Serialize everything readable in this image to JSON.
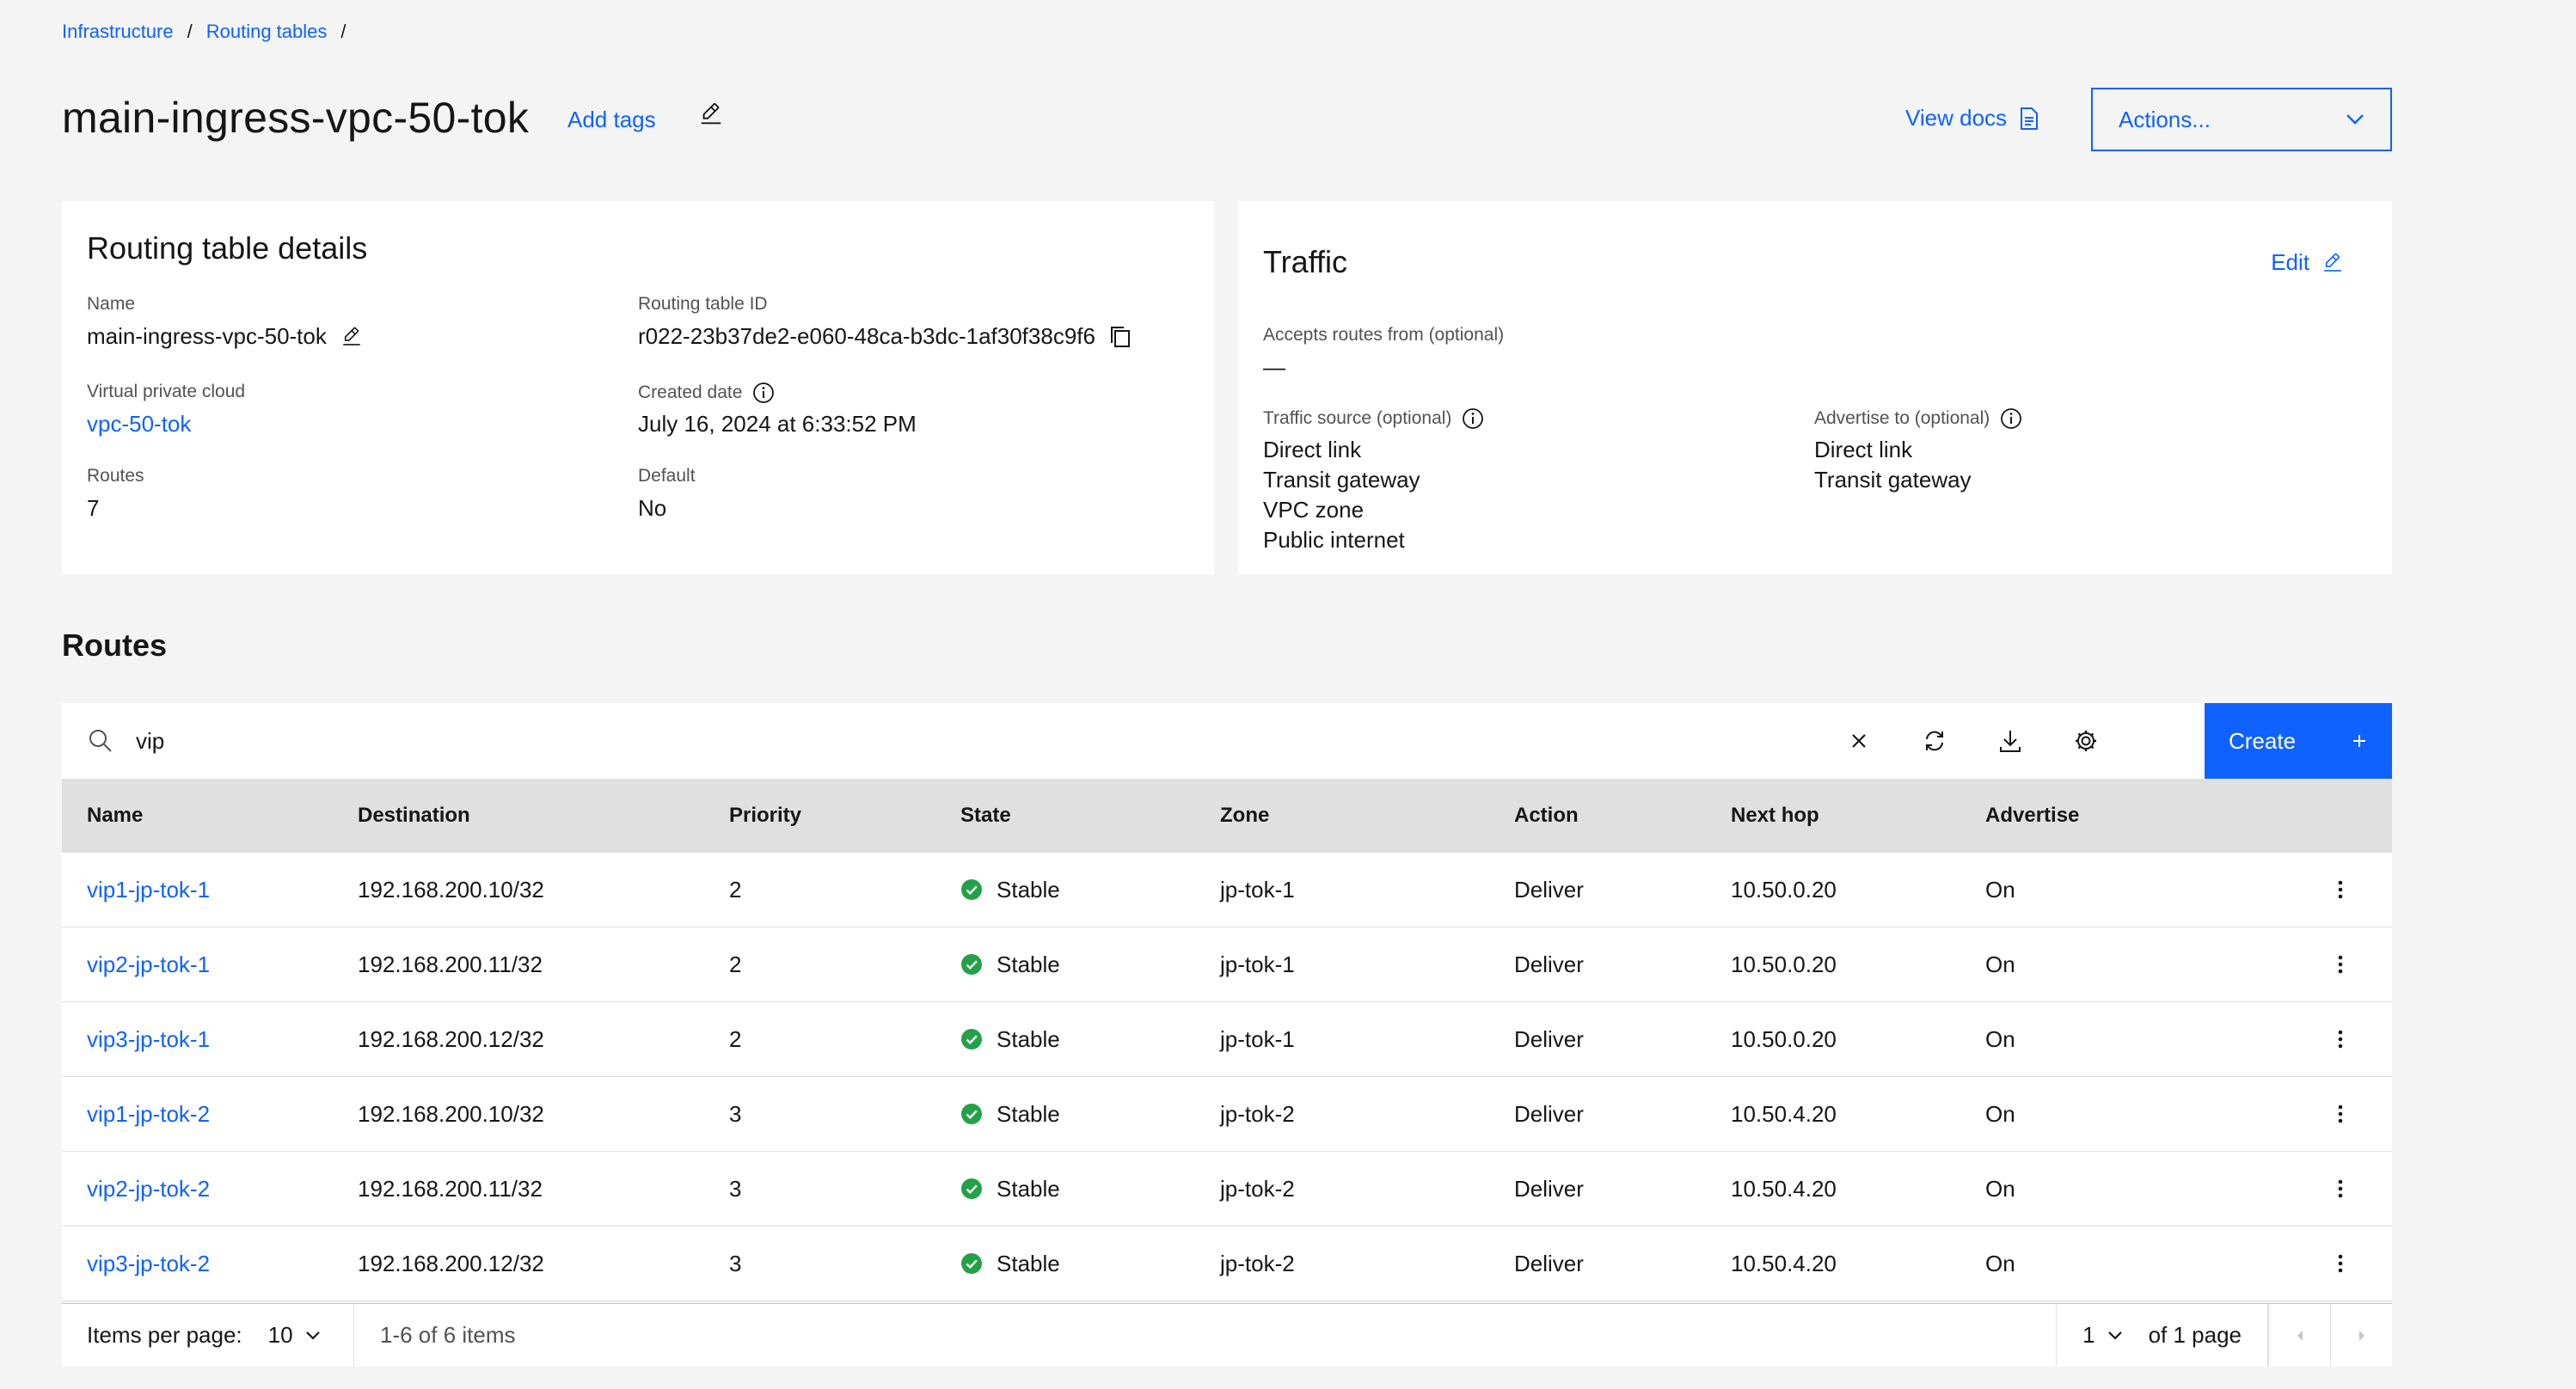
{
  "breadcrumb": {
    "items": [
      "Infrastructure",
      "Routing tables"
    ],
    "separator": "/"
  },
  "header": {
    "title": "main-ingress-vpc-50-tok",
    "add_tags": "Add tags",
    "view_docs": "View docs",
    "actions": "Actions..."
  },
  "details": {
    "title": "Routing table details",
    "name_label": "Name",
    "name_value": "main-ingress-vpc-50-tok",
    "id_label": "Routing table ID",
    "id_value": "r022-23b37de2-e060-48ca-b3dc-1af30f38c9f6",
    "vpc_label": "Virtual private cloud",
    "vpc_value": "vpc-50-tok",
    "created_label": "Created date",
    "created_value": "July 16, 2024 at 6:33:52 PM",
    "routes_label": "Routes",
    "routes_value": "7",
    "default_label": "Default",
    "default_value": "No"
  },
  "traffic": {
    "title": "Traffic",
    "edit": "Edit",
    "accepts_label": "Accepts routes from (optional)",
    "accepts_value": "—",
    "source_label": "Traffic source (optional)",
    "source_values": [
      "Direct link",
      "Transit gateway",
      "VPC zone",
      "Public internet"
    ],
    "advertise_label": "Advertise to (optional)",
    "advertise_values": [
      "Direct link",
      "Transit gateway"
    ]
  },
  "routes": {
    "title": "Routes",
    "search_value": "vip",
    "create": "Create",
    "columns": [
      "Name",
      "Destination",
      "Priority",
      "State",
      "Zone",
      "Action",
      "Next hop",
      "Advertise"
    ],
    "rows": [
      [
        "vip1-jp-tok-1",
        "192.168.200.10/32",
        "2",
        "Stable",
        "jp-tok-1",
        "Deliver",
        "10.50.0.20",
        "On"
      ],
      [
        "vip2-jp-tok-1",
        "192.168.200.11/32",
        "2",
        "Stable",
        "jp-tok-1",
        "Deliver",
        "10.50.0.20",
        "On"
      ],
      [
        "vip3-jp-tok-1",
        "192.168.200.12/32",
        "2",
        "Stable",
        "jp-tok-1",
        "Deliver",
        "10.50.0.20",
        "On"
      ],
      [
        "vip1-jp-tok-2",
        "192.168.200.10/32",
        "3",
        "Stable",
        "jp-tok-2",
        "Deliver",
        "10.50.4.20",
        "On"
      ],
      [
        "vip2-jp-tok-2",
        "192.168.200.11/32",
        "3",
        "Stable",
        "jp-tok-2",
        "Deliver",
        "10.50.4.20",
        "On"
      ],
      [
        "vip3-jp-tok-2",
        "192.168.200.12/32",
        "3",
        "Stable",
        "jp-tok-2",
        "Deliver",
        "10.50.4.20",
        "On"
      ]
    ]
  },
  "pagination": {
    "items_per_page_label": "Items per page:",
    "items_per_page": "10",
    "range": "1-6 of 6 items",
    "page": "1",
    "of_pages": "of 1 page"
  },
  "colors": {
    "link": "#0f62fe",
    "primary_button": "#0f62fe",
    "success": "#24a148",
    "header_row": "#e0e0e0",
    "background": "#f4f4f4"
  }
}
